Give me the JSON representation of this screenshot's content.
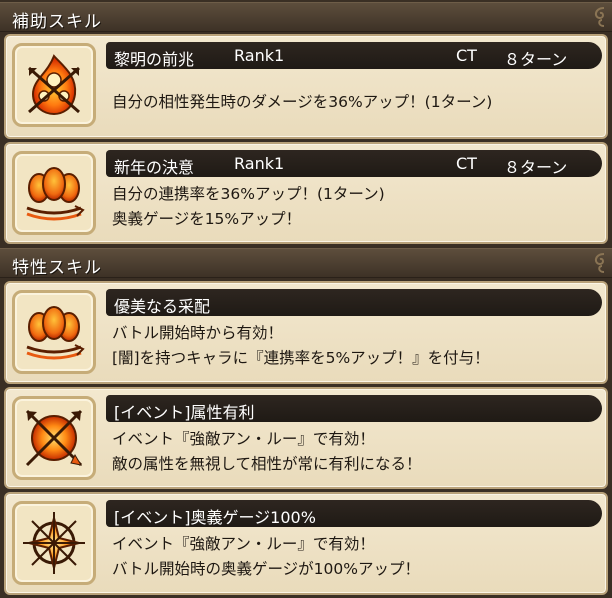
{
  "sections": {
    "support": {
      "title": "補助スキル"
    },
    "trait": {
      "title": "特性スキル"
    }
  },
  "support_skills": [
    {
      "name": "黎明の前兆",
      "rank": "Rank1",
      "ct_label": "CT",
      "ct_value": "８ターン",
      "icon": "fire-arrow-cross-icon",
      "desc": [
        "自分の相性発生時のダメージを36%アップ！(1ターン)"
      ]
    },
    {
      "name": "新年の決意",
      "rank": "Rank1",
      "ct_label": "CT",
      "ct_value": "８ターン",
      "icon": "triple-flame-icon",
      "desc": [
        "自分の連携率を36%アップ！(1ターン)",
        "奥義ゲージを15%アップ！"
      ]
    }
  ],
  "trait_skills": [
    {
      "name": "優美なる采配",
      "icon": "triple-flame-icon",
      "desc": [
        "バトル開始時から有効！",
        "[闇]を持つキャラに『連携率を5%アップ！』を付与！"
      ]
    },
    {
      "name": "[イベント]属性有利",
      "icon": "crossed-arrows-icon",
      "desc": [
        "イベント『強敵アン・ルー』で有効！",
        "敵の属性を無視して相性が常に有利になる！"
      ]
    },
    {
      "name": "[イベント]奥義ゲージ100%",
      "icon": "star-burst-icon",
      "desc": [
        "イベント『強敵アン・ルー』で有効！",
        "バトル開始時の奥義ゲージが100%アップ！"
      ]
    }
  ]
}
